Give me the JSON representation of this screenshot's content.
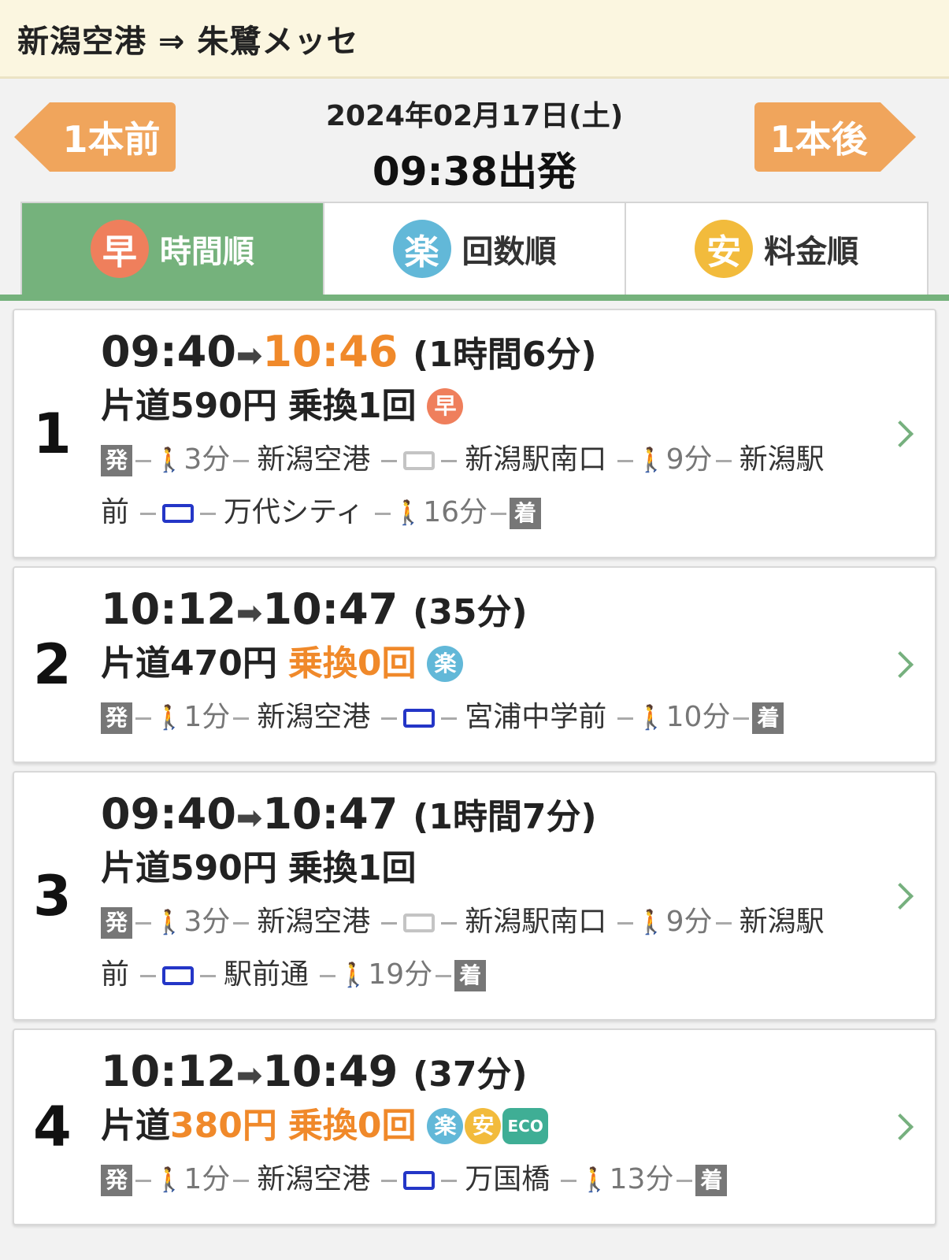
{
  "header": {
    "title": "新潟空港 ⇒ 朱鷺メッセ"
  },
  "datebar": {
    "prev_label": "1本前",
    "next_label": "1本後",
    "date": "2024年02月17日(土)",
    "departure": "09:38出発"
  },
  "tabs": [
    {
      "icon": "早",
      "label": "時間順",
      "color": "#ef7f5c",
      "active": true
    },
    {
      "icon": "楽",
      "label": "回数順",
      "color": "#62b8d8",
      "active": false
    },
    {
      "icon": "安",
      "label": "料金順",
      "color": "#f2bb3c",
      "active": false
    }
  ],
  "common": {
    "depart_pill": "発",
    "arrive_pill": "着",
    "eco": "ECO"
  },
  "results": [
    {
      "rank": "1",
      "dep": "09:40",
      "arr": "10:46",
      "dur": "(1時間6分)",
      "fare_prefix": "片道",
      "fare": "590円",
      "transfers": "乗換1回",
      "arr_orange": true,
      "fare_orange": false,
      "transfer_orange": false,
      "badges": [
        "早"
      ],
      "walk1": "3分",
      "stop1": "新潟空港",
      "stop2": "新潟駅南口",
      "walk2": "9分",
      "stop3": "新潟駅前",
      "stop4": "万代シティ",
      "walk3": "16分"
    },
    {
      "rank": "2",
      "dep": "10:12",
      "arr": "10:47",
      "dur": "(35分)",
      "fare_prefix": "片道",
      "fare": "470円",
      "transfers": "乗換0回",
      "arr_orange": false,
      "fare_orange": false,
      "transfer_orange": true,
      "badges": [
        "楽"
      ],
      "walk1": "1分",
      "stop1": "新潟空港",
      "stop2": "宮浦中学前",
      "walk2": "10分"
    },
    {
      "rank": "3",
      "dep": "09:40",
      "arr": "10:47",
      "dur": "(1時間7分)",
      "fare_prefix": "片道",
      "fare": "590円",
      "transfers": "乗換1回",
      "arr_orange": false,
      "fare_orange": false,
      "transfer_orange": false,
      "badges": [],
      "walk1": "3分",
      "stop1": "新潟空港",
      "stop2": "新潟駅南口",
      "walk2": "9分",
      "stop3": "新潟駅前",
      "stop4": "駅前通",
      "walk3": "19分"
    },
    {
      "rank": "4",
      "dep": "10:12",
      "arr": "10:49",
      "dur": "(37分)",
      "fare_prefix": "片道",
      "fare": "380円",
      "transfers": "乗換0回",
      "arr_orange": false,
      "fare_orange": true,
      "transfer_orange": true,
      "badges": [
        "楽",
        "安"
      ],
      "walk1": "1分",
      "stop1": "新潟空港",
      "stop2": "万国橋",
      "walk2": "13分"
    }
  ]
}
